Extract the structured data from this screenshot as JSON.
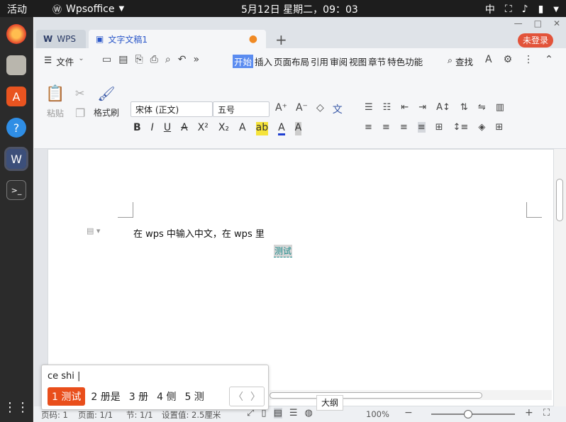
{
  "topbar": {
    "activities": "活动",
    "app_name": "Wpsoffice",
    "clock": "5月12日 星期二，09：03",
    "input_method": "中"
  },
  "tabs": [
    {
      "label": "WPS"
    },
    {
      "label": "文字文稿1"
    }
  ],
  "window": {
    "login_label": "未登录"
  },
  "menu": {
    "file": "文件",
    "items": [
      "开始",
      "插入",
      "页面布局",
      "引用",
      "审阅",
      "视图",
      "章节",
      "特色功能"
    ],
    "search": "查找"
  },
  "ribbon": {
    "paste": "粘贴",
    "format_painter": "格式刷",
    "font_name": "宋体 (正文)",
    "font_size": "五号"
  },
  "document": {
    "line1": "在 wps 中输入中文，在 wps 里",
    "composing": "测试"
  },
  "ime": {
    "input": "ce shi |",
    "candidates": [
      "测试",
      "册是",
      "册",
      "侧",
      "测"
    ]
  },
  "tooltip": "大纲",
  "status": {
    "a": "页码: 1",
    "b": "页面: 1/1",
    "c": "节: 1/1",
    "d": "设置值: 2.5厘米",
    "zoom": "100%"
  },
  "colors": {
    "accent": "#2c58c9",
    "ime_highlight": "#e94e1b",
    "login": "#e2533a"
  }
}
